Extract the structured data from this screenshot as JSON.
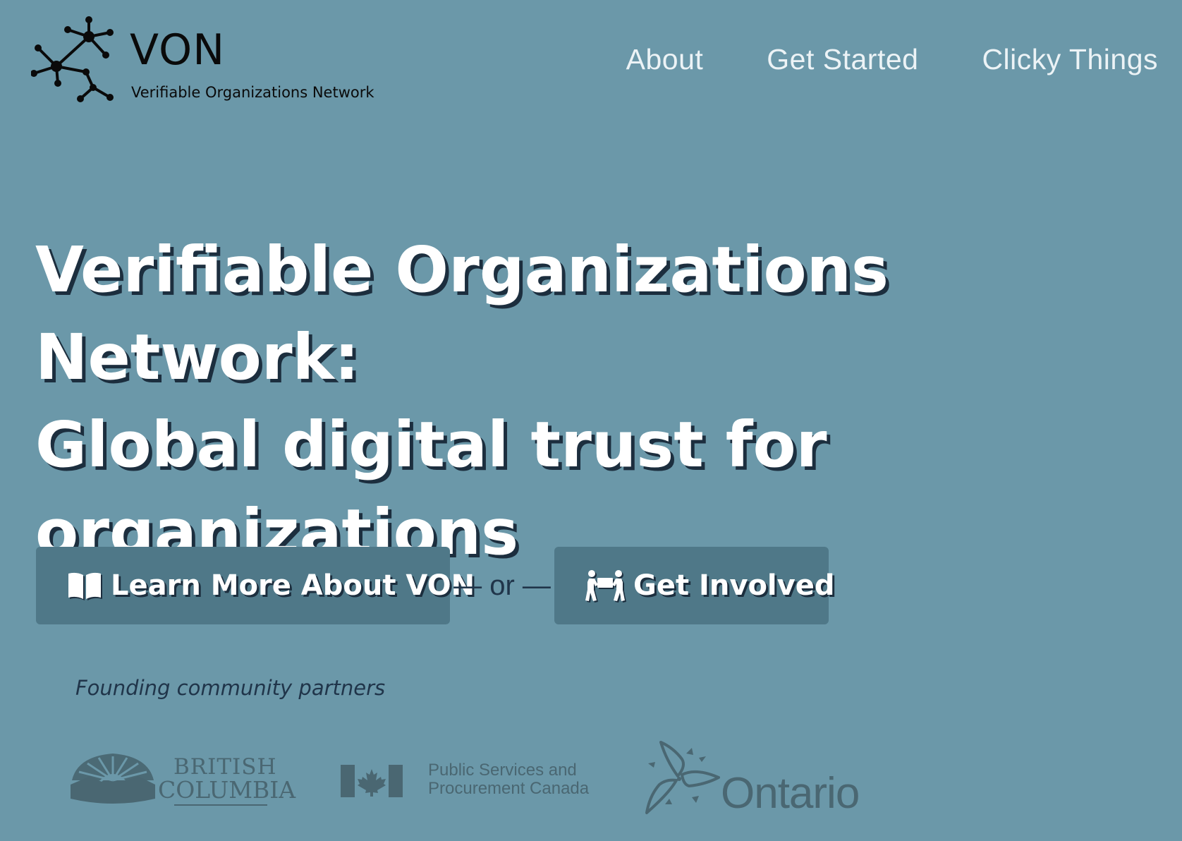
{
  "header": {
    "logo": {
      "icon": "network-graph-icon",
      "title": "VON",
      "subtitle": "Verifiable Organizations Network"
    },
    "nav": [
      {
        "label": "About"
      },
      {
        "label": "Get Started"
      },
      {
        "label": "Clicky Things"
      }
    ]
  },
  "hero": {
    "title_line1": "Verifiable Organizations Network:",
    "title_line2": "Global digital trust for",
    "title_line3": "organizations",
    "learn_button": {
      "label": "Learn More About VON",
      "icon": "open-book-icon"
    },
    "separator": "— or —",
    "involved_button": {
      "label": "Get Involved",
      "icon": "people-carry-box-icon"
    }
  },
  "partners": {
    "caption": "Founding community partners",
    "british_columbia": {
      "line1": "BRITISH",
      "line2": "COLUMBIA",
      "icon": "bc-sunrise-logo"
    },
    "pspc": {
      "line1": "Public Services and",
      "line2": "Procurement Canada",
      "icon": "canada-flag-icon"
    },
    "ontario": {
      "word": "Ontario",
      "icon": "ontario-trillium-logo"
    }
  },
  "colors": {
    "background": "#6b98a9",
    "button": "#4f7888",
    "text_shadow": "#1c2e3e",
    "logo_text": "#0a0a0a",
    "partner_logo": "#4a6772",
    "caption": "#20354a"
  }
}
